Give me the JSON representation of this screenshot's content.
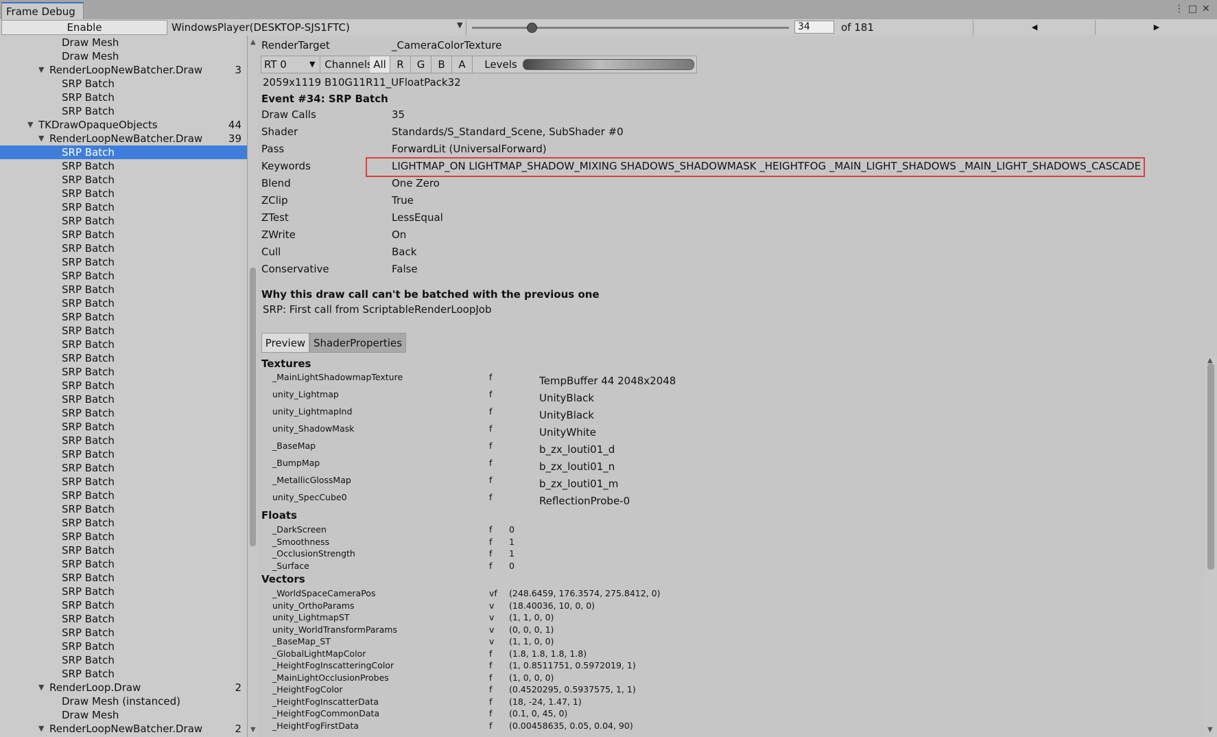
{
  "window": {
    "tab_title": "Frame Debug",
    "menu_icon": "⋮",
    "maximize_icon": "□",
    "close_icon": "✕"
  },
  "toolbar": {
    "enable_label": "Enable",
    "player": "WindowsPlayer(DESKTOP-SJS1FTC)",
    "event_index": "34",
    "event_total": "of 181",
    "event_progress_fraction": 0.188
  },
  "tree": [
    {
      "label": "Draw Mesh",
      "indent": 2
    },
    {
      "label": "Draw Mesh",
      "indent": 2
    },
    {
      "label": "RenderLoopNewBatcher.Draw",
      "indent": 1,
      "count": "3",
      "expanded": true
    },
    {
      "label": "SRP Batch",
      "indent": 2
    },
    {
      "label": "SRP Batch",
      "indent": 2
    },
    {
      "label": "SRP Batch",
      "indent": 2
    },
    {
      "label": "TKDrawOpaqueObjects",
      "indent": 0,
      "count": "44",
      "expanded": true
    },
    {
      "label": "RenderLoopNewBatcher.Draw",
      "indent": 1,
      "count": "39",
      "expanded": true
    },
    {
      "label": "SRP Batch",
      "indent": 2,
      "selected": true
    },
    {
      "label": "SRP Batch",
      "indent": 2
    },
    {
      "label": "SRP Batch",
      "indent": 2
    },
    {
      "label": "SRP Batch",
      "indent": 2
    },
    {
      "label": "SRP Batch",
      "indent": 2
    },
    {
      "label": "SRP Batch",
      "indent": 2
    },
    {
      "label": "SRP Batch",
      "indent": 2
    },
    {
      "label": "SRP Batch",
      "indent": 2
    },
    {
      "label": "SRP Batch",
      "indent": 2
    },
    {
      "label": "SRP Batch",
      "indent": 2
    },
    {
      "label": "SRP Batch",
      "indent": 2
    },
    {
      "label": "SRP Batch",
      "indent": 2
    },
    {
      "label": "SRP Batch",
      "indent": 2
    },
    {
      "label": "SRP Batch",
      "indent": 2
    },
    {
      "label": "SRP Batch",
      "indent": 2
    },
    {
      "label": "SRP Batch",
      "indent": 2
    },
    {
      "label": "SRP Batch",
      "indent": 2
    },
    {
      "label": "SRP Batch",
      "indent": 2
    },
    {
      "label": "SRP Batch",
      "indent": 2
    },
    {
      "label": "SRP Batch",
      "indent": 2
    },
    {
      "label": "SRP Batch",
      "indent": 2
    },
    {
      "label": "SRP Batch",
      "indent": 2
    },
    {
      "label": "SRP Batch",
      "indent": 2
    },
    {
      "label": "SRP Batch",
      "indent": 2
    },
    {
      "label": "SRP Batch",
      "indent": 2
    },
    {
      "label": "SRP Batch",
      "indent": 2
    },
    {
      "label": "SRP Batch",
      "indent": 2
    },
    {
      "label": "SRP Batch",
      "indent": 2
    },
    {
      "label": "SRP Batch",
      "indent": 2
    },
    {
      "label": "SRP Batch",
      "indent": 2
    },
    {
      "label": "SRP Batch",
      "indent": 2
    },
    {
      "label": "SRP Batch",
      "indent": 2
    },
    {
      "label": "SRP Batch",
      "indent": 2
    },
    {
      "label": "SRP Batch",
      "indent": 2
    },
    {
      "label": "SRP Batch",
      "indent": 2
    },
    {
      "label": "SRP Batch",
      "indent": 2
    },
    {
      "label": "SRP Batch",
      "indent": 2
    },
    {
      "label": "SRP Batch",
      "indent": 2
    },
    {
      "label": "SRP Batch",
      "indent": 2
    },
    {
      "label": "RenderLoop.Draw",
      "indent": 1,
      "count": "2",
      "expanded": true
    },
    {
      "label": "Draw Mesh (instanced)",
      "indent": 2
    },
    {
      "label": "Draw Mesh",
      "indent": 2
    },
    {
      "label": "RenderLoopNewBatcher.Draw",
      "indent": 1,
      "count": "2",
      "expanded": true
    }
  ],
  "render_target": {
    "label": "RenderTarget",
    "value": "_CameraColorTexture"
  },
  "rt_bar": {
    "rt": "RT 0",
    "channels_label": "Channels",
    "channels": [
      "All",
      "R",
      "G",
      "B",
      "A"
    ],
    "levels_label": "Levels"
  },
  "format": "2059x1119 B10G11R11_UFloatPack32",
  "event_title": "Event #34: SRP Batch",
  "props": [
    {
      "label": "Draw Calls",
      "value": "35"
    },
    {
      "label": "Shader",
      "value": "Standards/S_Standard_Scene, SubShader #0"
    },
    {
      "label": "Pass",
      "value": "ForwardLit (UniversalForward)"
    },
    {
      "label": "Keywords",
      "value": "LIGHTMAP_ON LIGHTMAP_SHADOW_MIXING SHADOWS_SHADOWMASK _HEIGHTFOG _MAIN_LIGHT_SHADOWS _MAIN_LIGHT_SHADOWS_CASCADE"
    },
    {
      "label": "Blend",
      "value": "One Zero"
    },
    {
      "label": "ZClip",
      "value": "True"
    },
    {
      "label": "ZTest",
      "value": "LessEqual"
    },
    {
      "label": "ZWrite",
      "value": "On"
    },
    {
      "label": "Cull",
      "value": "Back"
    },
    {
      "label": "Conservative",
      "value": "False"
    }
  ],
  "batch_reason": {
    "title": "Why this draw call can't be batched with the previous one",
    "text": "SRP: First call from ScriptableRenderLoopJob"
  },
  "tabs": {
    "preview": "Preview",
    "shader_properties": "ShaderProperties"
  },
  "textures_title": "Textures",
  "textures": [
    {
      "name": "_MainLightShadowmapTexture",
      "flag": "f",
      "value": "TempBuffer 44 2048x2048"
    },
    {
      "name": "unity_Lightmap",
      "flag": "f",
      "value": "UnityBlack"
    },
    {
      "name": "unity_LightmapInd",
      "flag": "f",
      "value": "UnityBlack"
    },
    {
      "name": "unity_ShadowMask",
      "flag": "f",
      "value": "UnityWhite"
    },
    {
      "name": "_BaseMap",
      "flag": "f",
      "value": "b_zx_louti01_d"
    },
    {
      "name": "_BumpMap",
      "flag": "f",
      "value": "b_zx_louti01_n"
    },
    {
      "name": "_MetallicGlossMap",
      "flag": "f",
      "value": "b_zx_louti01_m"
    },
    {
      "name": "unity_SpecCube0",
      "flag": "f",
      "value": "ReflectionProbe-0"
    }
  ],
  "floats_title": "Floats",
  "floats": [
    {
      "name": "_DarkScreen",
      "flag": "f",
      "value": "0"
    },
    {
      "name": "_Smoothness",
      "flag": "f",
      "value": "1"
    },
    {
      "name": "_OcclusionStrength",
      "flag": "f",
      "value": "1"
    },
    {
      "name": "_Surface",
      "flag": "f",
      "value": "0"
    }
  ],
  "vectors_title": "Vectors",
  "vectors": [
    {
      "name": "_WorldSpaceCameraPos",
      "flag": "vf",
      "value": "(248.6459, 176.3574, 275.8412, 0)"
    },
    {
      "name": "unity_OrthoParams",
      "flag": "v",
      "value": "(18.40036, 10, 0, 0)"
    },
    {
      "name": "unity_LightmapST",
      "flag": "v",
      "value": "(1, 1, 0, 0)"
    },
    {
      "name": "unity_WorldTransformParams",
      "flag": "v",
      "value": "(0, 0, 0, 1)"
    },
    {
      "name": "_BaseMap_ST",
      "flag": "v",
      "value": "(1, 1, 0, 0)"
    },
    {
      "name": "_GlobalLightMapColor",
      "flag": "f",
      "value": "(1.8, 1.8, 1.8, 1.8)"
    },
    {
      "name": "_HeightFogInscatteringColor",
      "flag": "f",
      "value": "(1, 0.8511751, 0.5972019, 1)"
    },
    {
      "name": "_MainLightOcclusionProbes",
      "flag": "f",
      "value": "(1, 0, 0, 0)"
    },
    {
      "name": "_HeightFogColor",
      "flag": "f",
      "value": "(0.4520295, 0.5937575, 1, 1)"
    },
    {
      "name": "_HeightFogInscatterData",
      "flag": "f",
      "value": "(18, -24, 1.47, 1)"
    },
    {
      "name": "_HeightFogCommonData",
      "flag": "f",
      "value": "(0.1, 0, 45, 0)"
    },
    {
      "name": "_HeightFogFirstData",
      "flag": "f",
      "value": "(0.00458635, 0.05, 0.04, 90)"
    }
  ],
  "colors": {
    "selection": "#3e7ddb",
    "highlight_box": "#e03c3c",
    "tab_accent": "#3a72c4"
  }
}
